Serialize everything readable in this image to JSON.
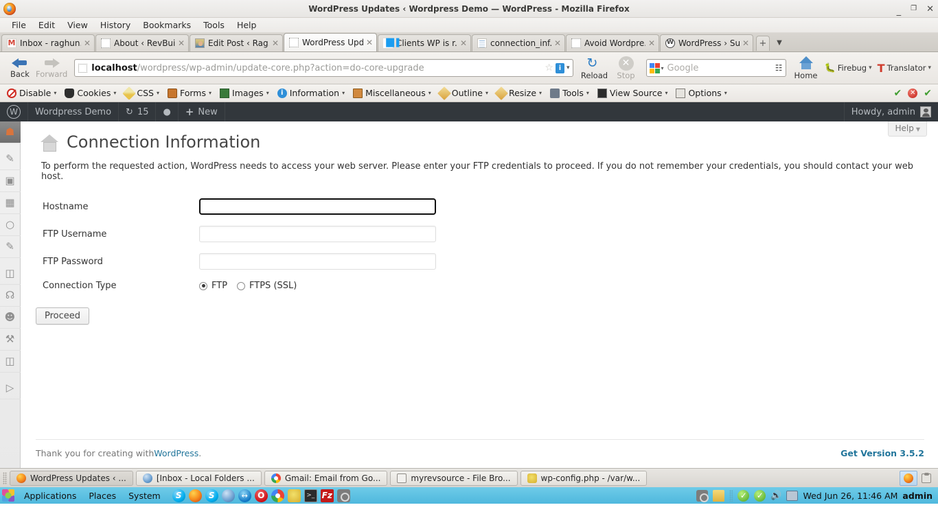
{
  "window": {
    "title": "WordPress Updates ‹ Wordpress Demo — WordPress - Mozilla Firefox",
    "minimize": "_",
    "maximize": "❐",
    "close": "✕"
  },
  "menubar": [
    {
      "label": "File"
    },
    {
      "label": "Edit"
    },
    {
      "label": "View"
    },
    {
      "label": "History"
    },
    {
      "label": "Bookmarks"
    },
    {
      "label": "Tools"
    },
    {
      "label": "Help"
    }
  ],
  "tabs": [
    {
      "label": "Inbox - raghun...",
      "icon": "gmail-favicon",
      "active": false
    },
    {
      "label": "About ‹ RevBuil...",
      "icon": "blank-favicon",
      "active": false
    },
    {
      "label": "Edit Post ‹ Rag...",
      "icon": "photo-favicon",
      "active": false
    },
    {
      "label": "WordPress Upd...",
      "icon": "blank-favicon",
      "active": true
    },
    {
      "label": "Clients WP is r...",
      "icon": "chart-favicon",
      "active": false
    },
    {
      "label": "connection_inf...",
      "icon": "document-favicon",
      "active": false
    },
    {
      "label": "Avoid Wordpre...",
      "icon": "blank-favicon",
      "active": false
    },
    {
      "label": "WordPress › Su...",
      "icon": "wordpress-favicon",
      "active": false
    }
  ],
  "tab_controls": {
    "new_tab": "+",
    "tab_list": "▼",
    "close": "✕"
  },
  "navbar": {
    "back_label": "Back",
    "forward_label": "Forward",
    "reload_label": "Reload",
    "stop_label": "Stop",
    "home_label": "Home",
    "firebug_label": "Firebug",
    "translator_label": "Translator",
    "translator_glyph": "T",
    "url_host": "localhost",
    "url_path": "/wordpress/wp-admin/update-core.php?action=do-core-upgrade",
    "url_star": "☆",
    "url_info_glyph": "i",
    "search_placeholder": "Google",
    "search_engine": "google-icon",
    "caret": "▾"
  },
  "devtoolbar": {
    "items": [
      {
        "label": "Disable",
        "icon": "disable-icon"
      },
      {
        "label": "Cookies",
        "icon": "cookie-icon"
      },
      {
        "label": "CSS",
        "icon": "css-icon"
      },
      {
        "label": "Forms",
        "icon": "forms-icon"
      },
      {
        "label": "Images",
        "icon": "images-icon"
      },
      {
        "label": "Information",
        "icon": "information-icon"
      },
      {
        "label": "Miscellaneous",
        "icon": "miscellaneous-icon"
      },
      {
        "label": "Outline",
        "icon": "outline-icon"
      },
      {
        "label": "Resize",
        "icon": "resize-icon"
      },
      {
        "label": "Tools",
        "icon": "tools-icon"
      },
      {
        "label": "View Source",
        "icon": "view-source-icon"
      },
      {
        "label": "Options",
        "icon": "options-icon"
      }
    ],
    "caret": "▾",
    "status": {
      "check1": "✔",
      "error": "✕",
      "check2": "✔"
    }
  },
  "wpadminbar": {
    "logo": "W",
    "site_name": "Wordpress Demo",
    "updates_icon": "↻",
    "updates_count": "15",
    "comments_icon": "💬",
    "new_icon": "+",
    "new_label": "New",
    "howdy": "Howdy, admin"
  },
  "adminmenu": [
    {
      "name": "dashboard",
      "icon": "🏠",
      "current": true
    },
    {
      "name": "posts",
      "icon": "✎",
      "current": false
    },
    {
      "name": "media",
      "icon": "🖼",
      "current": false
    },
    {
      "name": "pages",
      "icon": "📄",
      "current": false
    },
    {
      "name": "comments",
      "icon": "💬",
      "current": false
    },
    {
      "name": "revslider",
      "icon": "✎",
      "current": false
    },
    {
      "name": "appearance",
      "icon": "▤",
      "current": false
    },
    {
      "name": "plugins",
      "icon": "🔌",
      "current": false
    },
    {
      "name": "users",
      "icon": "👥",
      "current": false
    },
    {
      "name": "tools",
      "icon": "⚒",
      "current": false
    },
    {
      "name": "settings",
      "icon": "⚙",
      "current": false
    },
    {
      "name": "collapse",
      "icon": "▶",
      "current": false
    }
  ],
  "page": {
    "help_label": "Help",
    "help_caret": "▼",
    "title": "Connection Information",
    "intro": "To perform the requested action, WordPress needs to access your web server. Please enter your FTP credentials to proceed. If you do not remember your credentials, you should contact your web host.",
    "fields": [
      {
        "label": "Hostname",
        "value": "",
        "placeholder": "",
        "type": "text",
        "focused": true
      },
      {
        "label": "FTP Username",
        "value": "",
        "placeholder": "",
        "type": "text",
        "focused": false
      },
      {
        "label": "FTP Password",
        "value": "",
        "placeholder": "",
        "type": "password",
        "focused": false
      }
    ],
    "connection_type": {
      "label": "Connection Type",
      "options": [
        {
          "label": "FTP",
          "selected": true
        },
        {
          "label": "FTPS (SSL)",
          "selected": false
        }
      ]
    },
    "submit_label": "Proceed",
    "footer_text": "Thank you for creating with ",
    "footer_link": "WordPress",
    "footer_period": ".",
    "footer_version": "Get Version 3.5.2"
  },
  "taskbar": {
    "windows": [
      {
        "label": "WordPress Updates ‹ ...",
        "icon": "firefox-icon",
        "active": true
      },
      {
        "label": "[Inbox - Local Folders ...",
        "icon": "thunderbird-icon",
        "active": false
      },
      {
        "label": "Gmail: Email from Go...",
        "icon": "chrome-icon",
        "active": false
      },
      {
        "label": "myrevsource - File Bro...",
        "icon": "filebrowser-icon",
        "active": false
      },
      {
        "label": "wp-config.php - /var/w...",
        "icon": "kate-icon",
        "active": false
      }
    ],
    "tray": [
      {
        "name": "firefox-tray-icon",
        "selected": true
      },
      {
        "name": "clipboard-tray-icon",
        "selected": false
      }
    ]
  },
  "gnomepanel": {
    "menus": [
      {
        "label": "Applications"
      },
      {
        "label": "Places"
      },
      {
        "label": "System"
      }
    ],
    "launchers": [
      {
        "name": "skype-icon"
      },
      {
        "name": "firefox-icon"
      },
      {
        "name": "skype-icon-2"
      },
      {
        "name": "thunderbird-icon"
      },
      {
        "name": "teamviewer-icon"
      },
      {
        "name": "opera-icon"
      },
      {
        "name": "chrome-icon"
      },
      {
        "name": "kate-icon"
      },
      {
        "name": "terminal-icon"
      },
      {
        "name": "filezilla-icon"
      },
      {
        "name": "screenshot-icon"
      }
    ],
    "tray": [
      {
        "name": "screenshot-icon"
      },
      {
        "name": "folder-icon"
      },
      {
        "name": "dropbox-check-icon"
      },
      {
        "name": "update-check-icon"
      },
      {
        "name": "volume-icon"
      },
      {
        "name": "network-icon"
      }
    ],
    "clock": "Wed Jun 26, 11:46 AM",
    "user": "admin"
  }
}
